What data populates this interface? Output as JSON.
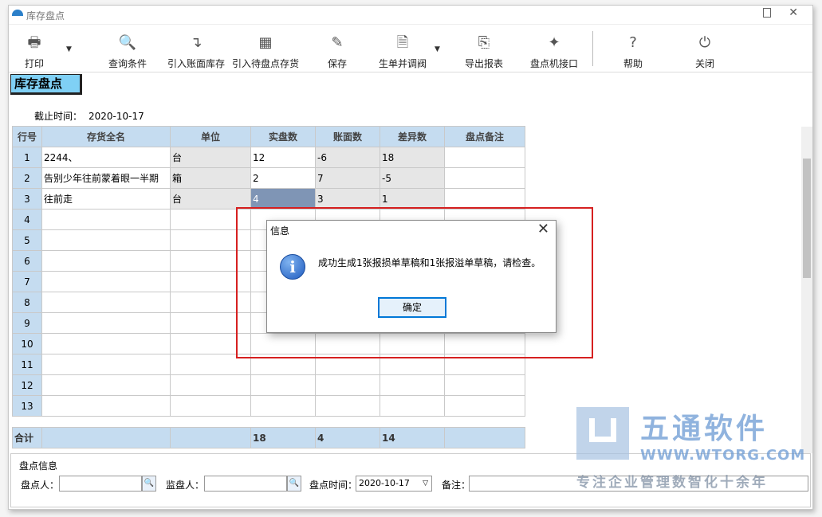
{
  "window": {
    "title": "库存盘点"
  },
  "toolbar": {
    "print": "打印",
    "query": "查询条件",
    "import_book": "引入账面库存",
    "import_pending": "引入待盘点存货",
    "save": "保存",
    "generate": "生单并调阀",
    "export": "导出报表",
    "device": "盘点机接口",
    "help": "帮助",
    "close": "关闭"
  },
  "module_title": "库存盘点",
  "deadline": {
    "label": "截止时间：",
    "value": "2020-10-17"
  },
  "grid": {
    "headers": [
      "行号",
      "存货全名",
      "单位",
      "实盘数",
      "账面数",
      "差异数",
      "盘点备注"
    ],
    "rows": [
      [
        "1",
        "2244、",
        "台",
        "12",
        "-6",
        "18",
        ""
      ],
      [
        "2",
        "告别少年往前蒙着眼一半期",
        "箱",
        "2",
        "7",
        "-5",
        ""
      ],
      [
        "3",
        "往前走",
        "台",
        "4",
        "3",
        "1",
        ""
      ],
      [
        "4",
        "",
        "",
        "",
        "",
        "",
        ""
      ],
      [
        "5",
        "",
        "",
        "",
        "",
        "",
        ""
      ],
      [
        "6",
        "",
        "",
        "",
        "",
        "",
        ""
      ],
      [
        "7",
        "",
        "",
        "",
        "",
        "",
        ""
      ],
      [
        "8",
        "",
        "",
        "",
        "",
        "",
        ""
      ],
      [
        "9",
        "",
        "",
        "",
        "",
        "",
        ""
      ],
      [
        "10",
        "",
        "",
        "",
        "",
        "",
        ""
      ],
      [
        "11",
        "",
        "",
        "",
        "",
        "",
        ""
      ],
      [
        "12",
        "",
        "",
        "",
        "",
        "",
        ""
      ],
      [
        "13",
        "",
        "",
        "",
        "",
        "",
        ""
      ]
    ],
    "total": [
      "合计",
      "",
      "",
      "18",
      "4",
      "14",
      ""
    ]
  },
  "count_info": {
    "title": "盘点信息",
    "counter_label": "盘点人：",
    "counter_value": "",
    "supervisor_label": "监盘人：",
    "supervisor_value": "",
    "time_label": "盘点时间：",
    "time_value": "2020-10-17",
    "note_label": "备注：",
    "note_value": ""
  },
  "dialog": {
    "title": "信息",
    "message": "成功生成1张报损单草稿和1张报溢单草稿，请检查。",
    "ok": "确定"
  },
  "watermark": {
    "name": "五通软件",
    "url": "WWW.WTORG.COM",
    "slogan": "专注企业管理数智化十余年"
  },
  "colors": {
    "grid_header": "#c5dcf0",
    "module_title_bg": "#7fd0f5",
    "highlight": "#d62020",
    "selected_cell": "#7f95b5"
  }
}
